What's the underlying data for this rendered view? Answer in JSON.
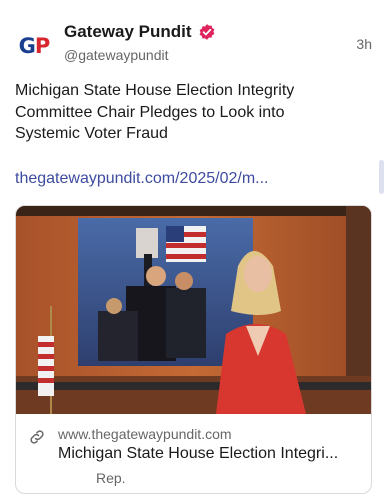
{
  "account": {
    "avatar_letters": "GP",
    "display_name": "Gateway Pundit",
    "handle": "@gatewaypundit",
    "timestamp": "3h",
    "verified_color": "#e0245e"
  },
  "post": {
    "text": "Michigan State House Election Integrity Committee Chair Pledges to Look into Systemic Voter Fraud",
    "link_text": "thegatewaypundit.com/2025/02/m..."
  },
  "card": {
    "domain": "www.thegatewaypundit.com",
    "title": "Michigan State House Election Integri...",
    "description": "Rep."
  },
  "colors": {
    "link": "#3d4ba0",
    "brand_blue": "#1b3f8f",
    "brand_red": "#d8262f"
  }
}
